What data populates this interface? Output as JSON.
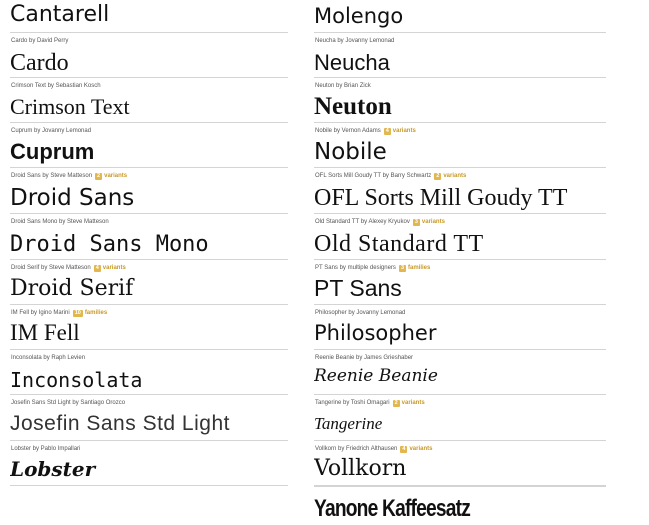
{
  "left": [
    {
      "meta": "",
      "sample": "Cantarell"
    },
    {
      "meta": "Cardo by David Perry",
      "sample": "Cardo"
    },
    {
      "meta": "Crimson Text by Sebastian Kosch",
      "sample": "Crimson Text"
    },
    {
      "meta": "Cuprum by Jovanny Lemonad",
      "sample": "Cuprum"
    },
    {
      "meta": "Droid Sans by Steve Matteson",
      "badge": "2",
      "badge_label": "variants",
      "sample": "Droid Sans"
    },
    {
      "meta": "Droid Sans Mono by Steve Matteson",
      "sample": "Droid Sans Mono"
    },
    {
      "meta": "Droid Serif by Steve Matteson",
      "badge": "4",
      "badge_label": "variants",
      "sample": "Droid Serif"
    },
    {
      "meta": "IM Fell by Igino Marini",
      "badge": "10",
      "badge_label": "families",
      "sample": "IM Fell"
    },
    {
      "meta": "Inconsolata by Raph Levien",
      "sample": "Inconsolata"
    },
    {
      "meta": "Josefin Sans Std Light by Santiago Orozco",
      "sample": "Josefin Sans Std Light"
    },
    {
      "meta": "Lobster by Pablo Impallari",
      "sample": "Lobster"
    }
  ],
  "right": [
    {
      "meta": "",
      "sample": "Molengo"
    },
    {
      "meta": "Neucha by Jovanny Lemonad",
      "sample": "Neucha"
    },
    {
      "meta": "Neuton by Brian Zick",
      "sample": "Neuton"
    },
    {
      "meta": "Nobile by Vernon Adams",
      "badge": "4",
      "badge_label": "variants",
      "sample": "Nobile"
    },
    {
      "meta": "OFL Sorts Mill Goudy TT by Barry Schwartz",
      "badge": "2",
      "badge_label": "variants",
      "sample": "OFL Sorts Mill Goudy TT"
    },
    {
      "meta": "Old Standard TT by Alexey Kryukov",
      "badge": "3",
      "badge_label": "variants",
      "sample": "Old Standard TT"
    },
    {
      "meta": "PT Sans by multiple designers",
      "badge": "3",
      "badge_label": "families",
      "sample": "PT Sans"
    },
    {
      "meta": "Philosopher by Jovanny Lemonad",
      "sample": "Philosopher"
    },
    {
      "meta": "Reenie Beanie by James Grieshaber",
      "sample": "Reenie Beanie"
    },
    {
      "meta": "Tangerine by Toshi Omagari",
      "badge": "2",
      "badge_label": "variants",
      "sample": "Tangerine"
    },
    {
      "meta": "Vollkorn by Friedrich Althausen",
      "badge": "4",
      "badge_label": "variants",
      "sample": "Vollkorn"
    },
    {
      "meta": "",
      "sample": "Yanone Kaffeesatz"
    }
  ]
}
